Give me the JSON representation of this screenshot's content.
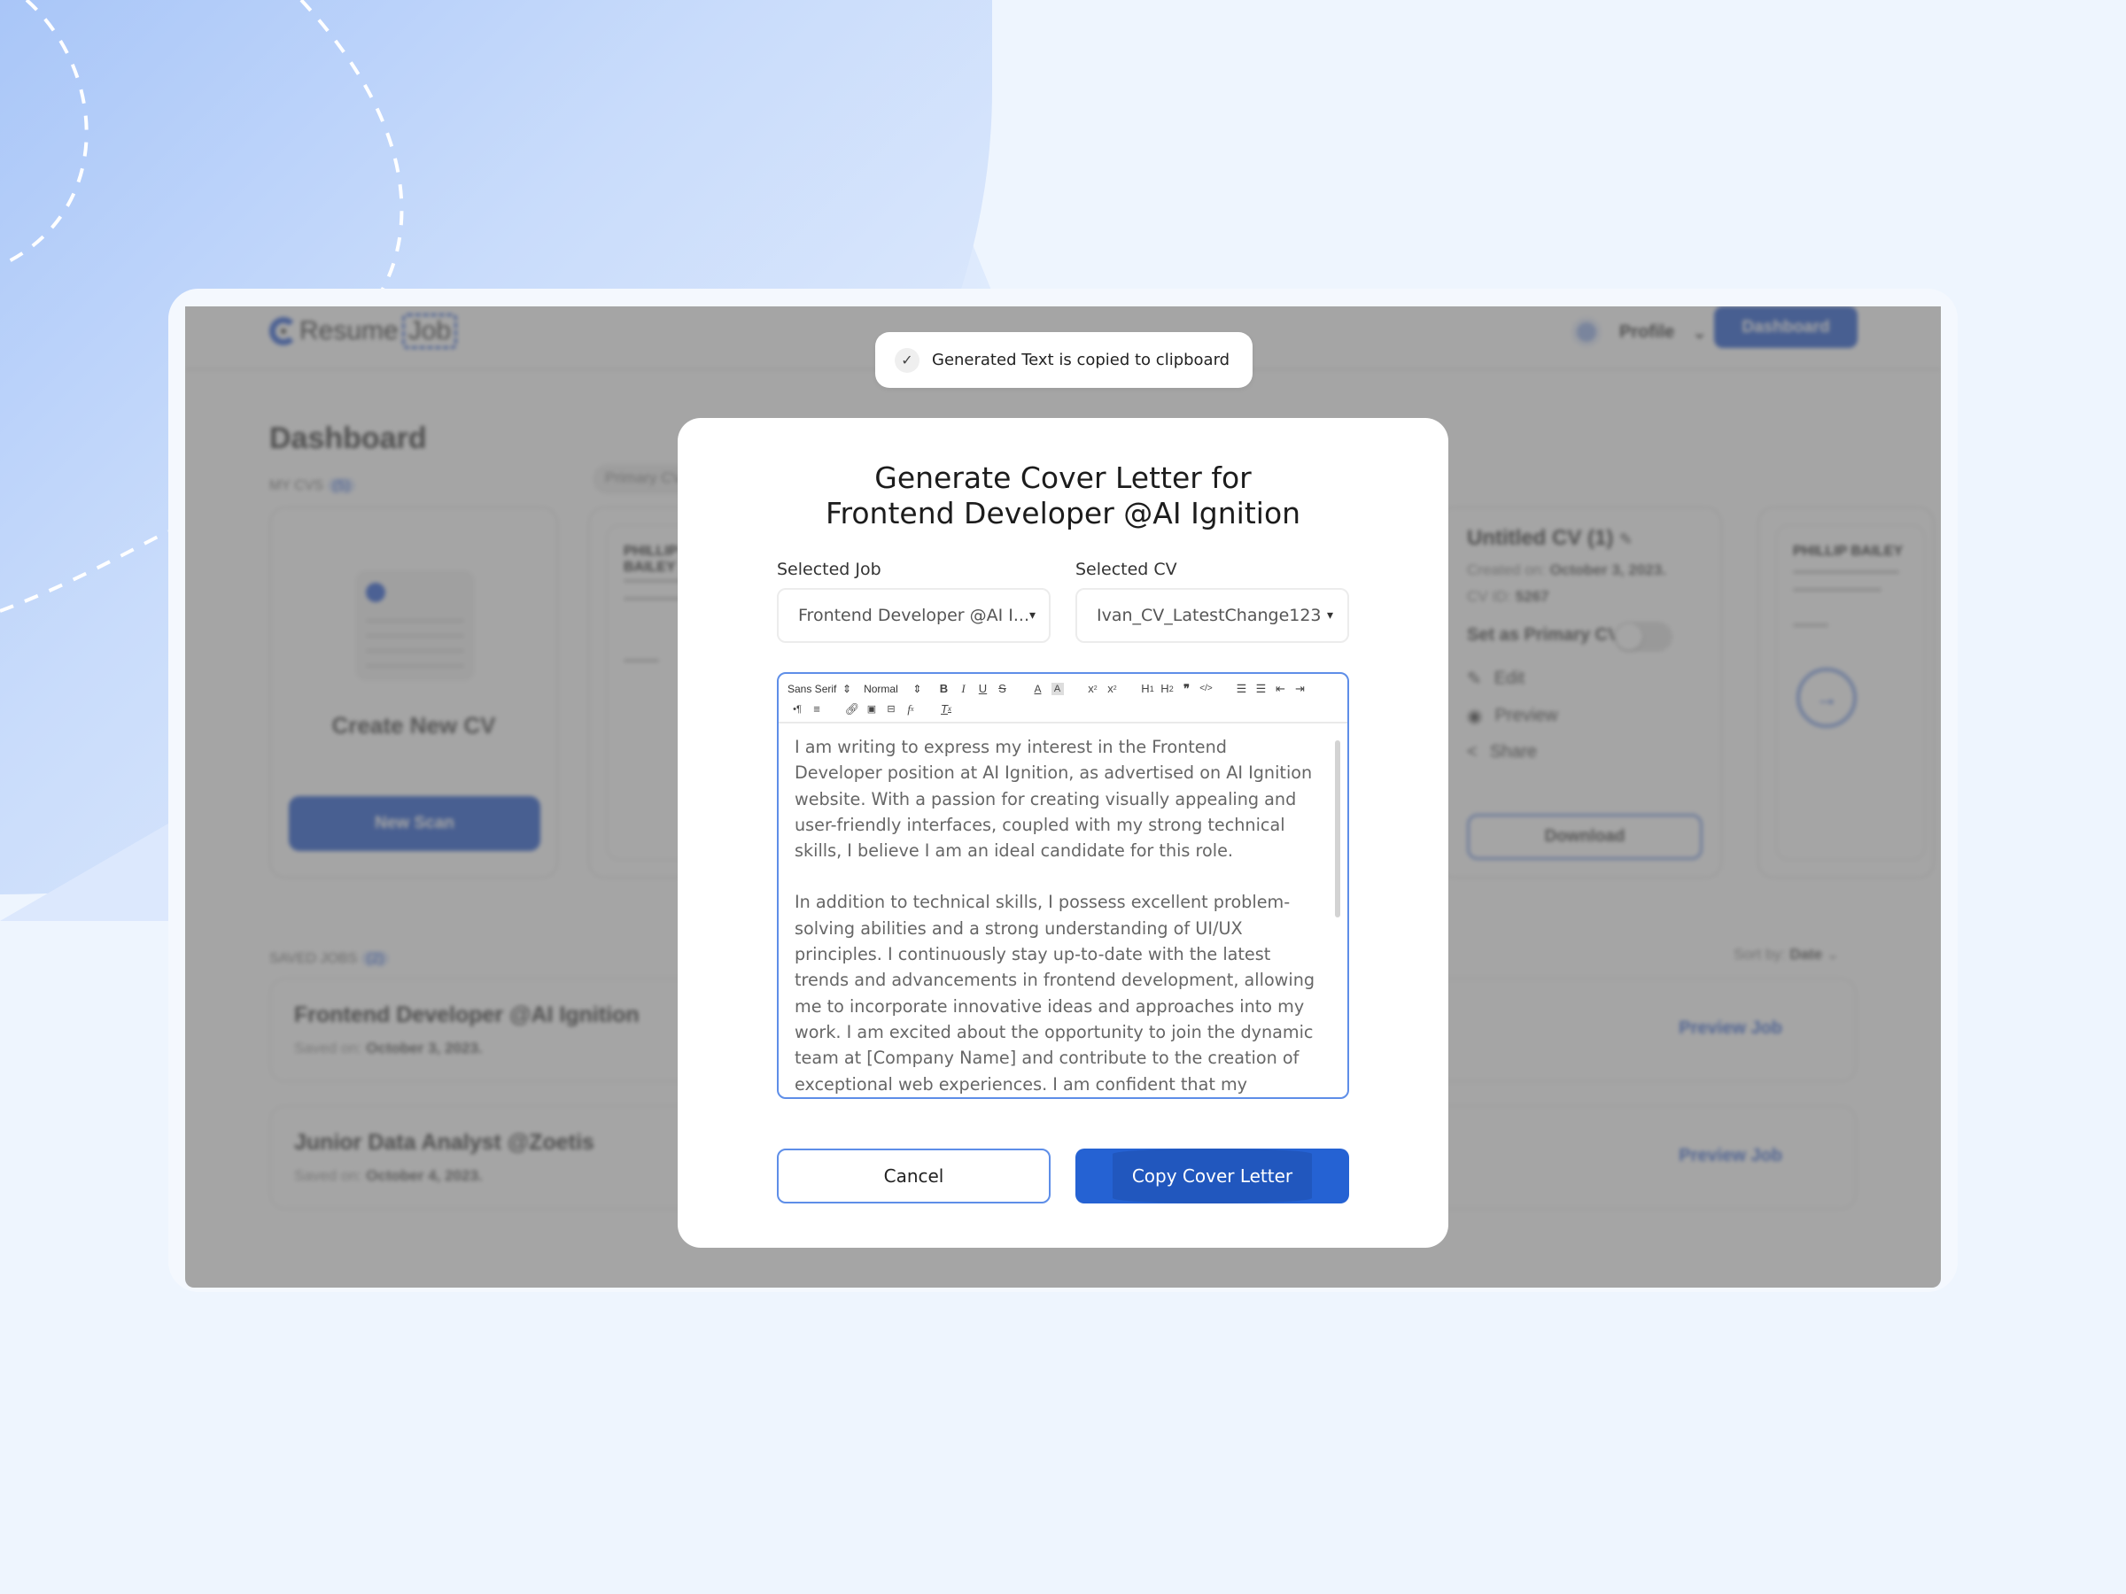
{
  "background_app": {
    "logo": {
      "part1": "Resume",
      "part2": "Job"
    },
    "header": {
      "profile_label": "Profile",
      "dashboard_button": "Dashboard"
    },
    "page_title": "Dashboard",
    "my_cvs": {
      "label": "MY CVS",
      "count": "5",
      "primary_pill": "Primary CV"
    },
    "create_card": {
      "title": "Create New CV",
      "button": "New Scan"
    },
    "resume_preview_name": "PHILLIP BAILEY",
    "cv_card": {
      "title": "Untitled CV (1)",
      "created_label": "Created on:",
      "created_value": "October 3, 2023.",
      "id_label": "CV ID:",
      "id_value": "5267",
      "primary_toggle_label": "Set as Primary CV",
      "primary_toggle_on": false,
      "actions": [
        "Edit",
        "Preview",
        "Share"
      ],
      "download_button": "Download"
    },
    "saved_jobs": {
      "label": "SAVED JOBS",
      "count": "2",
      "sort_label": "Sort by:",
      "sort_value": "Date",
      "items": [
        {
          "title": "Frontend Developer @AI Ignition",
          "saved_label": "Saved on:",
          "saved_date": "October 3, 2023.",
          "action": "Preview Job"
        },
        {
          "title": "Junior Data Analyst @Zoetis",
          "saved_label": "Saved on:",
          "saved_date": "October 4, 2023.",
          "action": "Preview Job"
        }
      ]
    }
  },
  "toast": {
    "icon": "check-icon",
    "message": "Generated Text is copied to clipboard"
  },
  "modal": {
    "title_line1": "Generate Cover Letter for",
    "title_line2": "Frontend Developer @AI Ignition",
    "selected_job": {
      "label": "Selected Job",
      "value": "Frontend Developer @AI I..."
    },
    "selected_cv": {
      "label": "Selected CV",
      "value": "Ivan_CV_LatestChange123"
    },
    "toolbar": {
      "font": "Sans Serif",
      "size": "Normal",
      "buttons": [
        "bold",
        "italic",
        "underline",
        "strike",
        "color",
        "background",
        "subscript",
        "superscript",
        "header-1",
        "header-2",
        "blockquote",
        "code-block",
        "ordered-list",
        "bullet-list",
        "outdent",
        "indent",
        "direction",
        "align",
        "link",
        "image",
        "video",
        "formula",
        "clean"
      ]
    },
    "body_paragraphs": [
      "I am writing to express my interest in the Frontend Developer position at AI Ignition, as advertised on AI Ignition website. With a passion for creating visually appealing and user-friendly interfaces, coupled with my strong technical skills, I believe I am an ideal candidate for this role.",
      "In addition to technical skills, I possess excellent problem-solving abilities and a strong understanding of UI/UX principles. I continuously stay up-to-date with the latest trends and advancements in frontend development, allowing me to incorporate innovative ideas and approaches into my work. I am excited about the opportunity to join the dynamic team at [Company Name] and contribute to the creation of exceptional web experiences. I am confident that my technical expertise, strong work ethic, and passion for frontend development make"
    ],
    "cancel_button": "Cancel",
    "copy_button": "Copy Cover Letter"
  },
  "colors": {
    "primary": "#2562d3",
    "editor_border": "#5e8ee8",
    "background": "#eef5fe"
  }
}
